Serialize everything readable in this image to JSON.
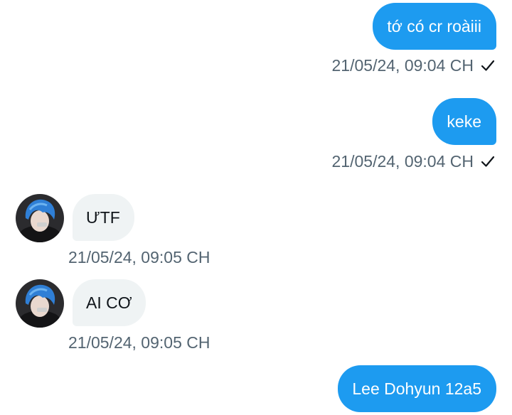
{
  "conversation": {
    "messages": [
      {
        "direction": "out",
        "text": "tớ có cr roàiii",
        "time": "21/05/24, 09:04 CH",
        "status_icon": "check-icon"
      },
      {
        "direction": "out",
        "text": "keke",
        "time": "21/05/24, 09:04 CH",
        "status_icon": "check-icon"
      },
      {
        "direction": "in",
        "text": "ƯTF",
        "time": "21/05/24, 09:05 CH",
        "avatar": "avatar-blue-hair"
      },
      {
        "direction": "in",
        "text": "AI CƠ",
        "time": "21/05/24, 09:05 CH",
        "avatar": "avatar-blue-hair"
      },
      {
        "direction": "out",
        "text": "Lee Dohyun 12a5"
      }
    ]
  },
  "colors": {
    "outgoing_bubble": "#1d9bf0",
    "incoming_bubble": "#eff3f4",
    "timestamp": "#536471",
    "avatar_hair": "#2f7fd6"
  }
}
